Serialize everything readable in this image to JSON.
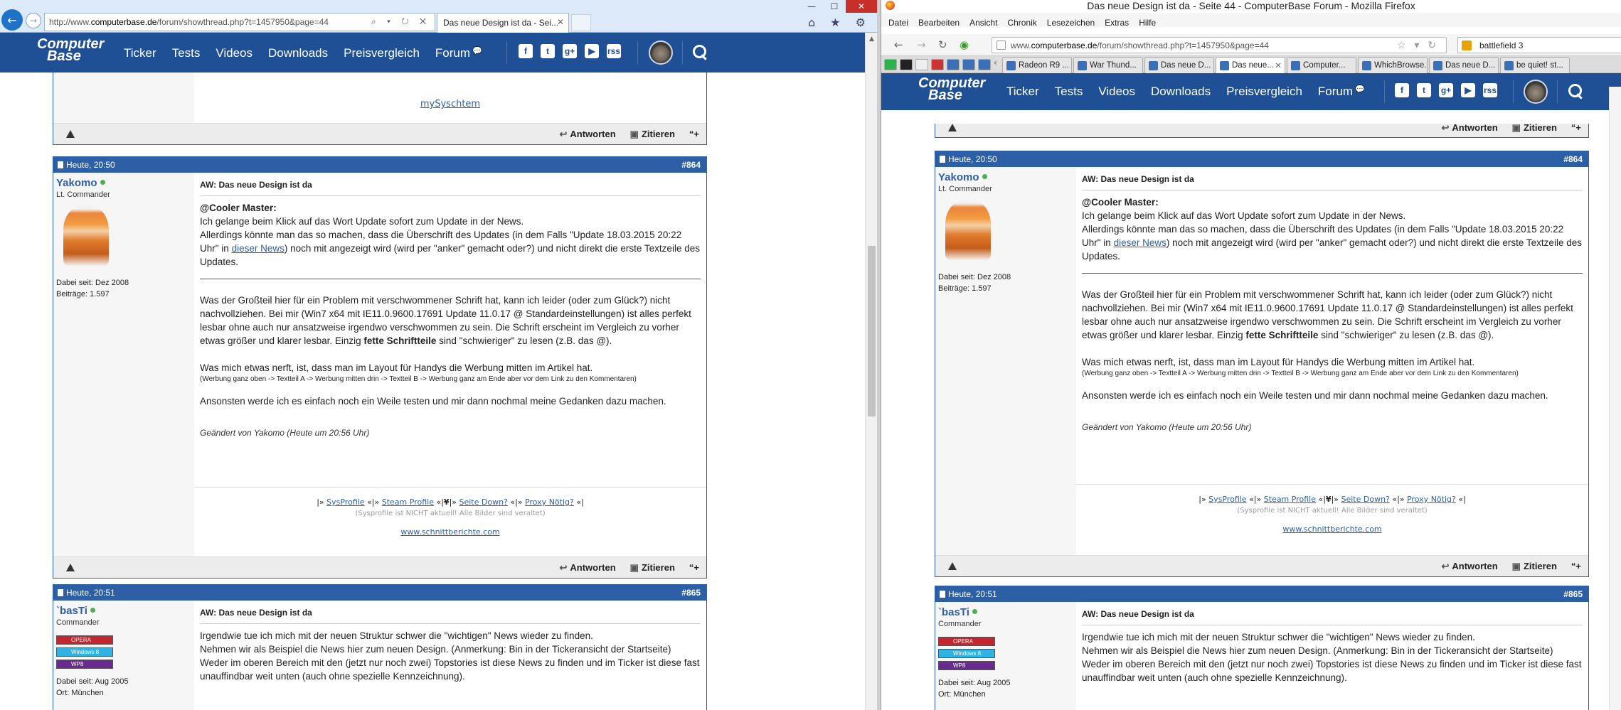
{
  "ie": {
    "url_prefix": "http://www.",
    "url_domain": "computerbase.de",
    "url_rest": "/forum/showthread.php?t=1457950&page=44",
    "tab_title": "Das neue Design ist da - Sei...",
    "address_icons": "⌕ ▾ ↻ ✕",
    "tools_icons": "⌂ ★ ⚙"
  },
  "ff": {
    "window_title": "Das neue Design ist da - Seite 44 - ComputerBase Forum - Mozilla Firefox",
    "menu": [
      "Datei",
      "Bearbeiten",
      "Ansicht",
      "Chronik",
      "Lesezeichen",
      "Extras",
      "Hilfe"
    ],
    "url_prefix": "www.",
    "url_domain": "computerbase.de",
    "url_rest": "/forum/showthread.php?t=1457950&page=44",
    "search_value": "battlefield 3",
    "tabs": [
      "Radeon R9 ...",
      "War Thund...",
      "Das neue D...",
      "Das neue...",
      "Computer...",
      "WhichBrowse...",
      "Das neue D...",
      "be quiet! st..."
    ]
  },
  "site": {
    "logo_line1": "Computer",
    "logo_line2": "Base",
    "nav": [
      "Ticker",
      "Tests",
      "Videos",
      "Downloads",
      "Preisvergleich",
      "Forum"
    ],
    "socials": [
      "f",
      "t",
      "g+",
      "▶",
      "rss"
    ]
  },
  "prev_post": {
    "sig_link": "mySyschtem"
  },
  "actions": {
    "reply": "Antworten",
    "quote": "Zitieren",
    "multiquote": "“+"
  },
  "post864": {
    "date": "Heute, 20:50",
    "number": "#864",
    "user": "Yakomo",
    "rank": "Lt. Commander",
    "joined": "Dabei seit: Dez 2008",
    "posts": "Beiträge: 1.597",
    "title": "AW: Das neue Design ist da",
    "quote_head": "@Cooler Master:",
    "p1": "Ich gelange beim Klick auf das Wort Update sofort zum Update in der News.",
    "p2a": "Allerdings könnte man das so machen, dass die Überschrift des Updates (in dem Falls \"Update 18.03.2015 20:22 Uhr\" in ",
    "p2link": "dieser News",
    "p2b": ") noch mit angezeigt wird (wird per \"anker\" gemacht oder?) und nicht direkt die erste Textzeile des Updates.",
    "p3a": "Was der Großteil hier für ein Problem mit verschwommener Schrift hat, kann ich leider (oder zum Glück?) nicht nachvollziehen. Bei mir (Win7 x64 mit IE11.0.9600.17691 Update 11.0.17 @ Standardeinstellungen) ist alles perfekt lesbar ohne auch nur ansatzweise irgendwo verschwommen zu sein. Die Schrift erscheint im Vergleich zu vorher etwas größer und klarer lesbar. Einzig ",
    "p3bold": "fette Schriftteile",
    "p3b": " sind \"schwieriger\" zu lesen (z.B. das @).",
    "p4": "Was mich etwas nerft, ist, dass man im Layout für Handys die Werbung mitten im Artikel hat.",
    "p4small": "(Werbung ganz oben -> Textteil A -> Werbung mitten drin -> Textteil B -> Werbung ganz am Ende aber vor dem Link zu den Kommentaren)",
    "p5": "Ansonsten werde ich es einfach noch ein Weile testen und mir dann nochmal meine Gedanken dazu machen.",
    "edited": "Geändert von Yakomo (Heute um 20:56 Uhr)",
    "sig_links": [
      "SysProfile",
      "Steam Profile",
      "Seite Down?",
      "Proxy Nötig?"
    ],
    "sig_note": "(Sysprofile ist NICHT aktuell! Alle Bilder sind veraltet)",
    "sig_site": "www.schnittberichte.com"
  },
  "post865": {
    "date": "Heute, 20:51",
    "number": "#865",
    "user": "`basTi",
    "rank": "Commander",
    "badges": [
      "OPERA",
      "Windows 8",
      "WP8"
    ],
    "joined": "Dabei seit: Aug 2005",
    "location": "Ort: München",
    "title": "AW: Das neue Design ist da",
    "p1": "Irgendwie tue ich mich mit der neuen Struktur schwer die \"wichtigen\" News wieder zu finden.",
    "p2": "Nehmen wir als Beispiel die News hier zum neuen Design. (Anmerkung: Bin in der Tickeransicht der Startseite)",
    "p3": "Weder im oberen Bereich mit den (jetzt nur noch zwei) Topstories ist diese News zu finden und im Ticker ist diese fast unauffindbar weit unten (auch ohne spezielle Kennzeichnung)."
  }
}
